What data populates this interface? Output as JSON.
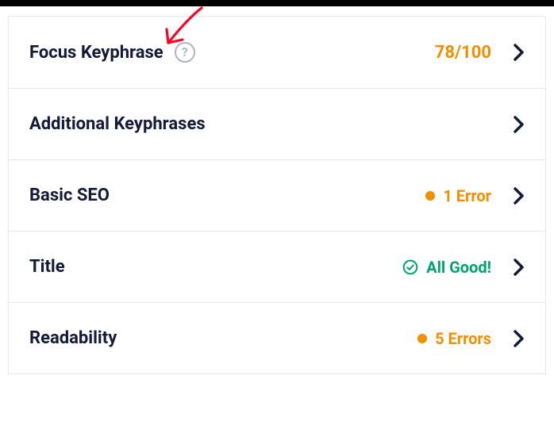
{
  "rows": [
    {
      "label": "Focus Keyphrase",
      "help": true,
      "score": "78/100",
      "status": null
    },
    {
      "label": "Additional Keyphrases",
      "help": false,
      "score": null,
      "status": null
    },
    {
      "label": "Basic SEO",
      "help": false,
      "score": null,
      "status": {
        "type": "error",
        "text": "1 Error"
      }
    },
    {
      "label": "Title",
      "help": false,
      "score": null,
      "status": {
        "type": "good",
        "text": "All Good!"
      }
    },
    {
      "label": "Readability",
      "help": false,
      "score": null,
      "status": {
        "type": "error",
        "text": "5 Errors"
      }
    }
  ],
  "colors": {
    "orange": "#f18f01",
    "green": "#00a36c",
    "text": "#141b38",
    "arrow": "#ff0024"
  }
}
